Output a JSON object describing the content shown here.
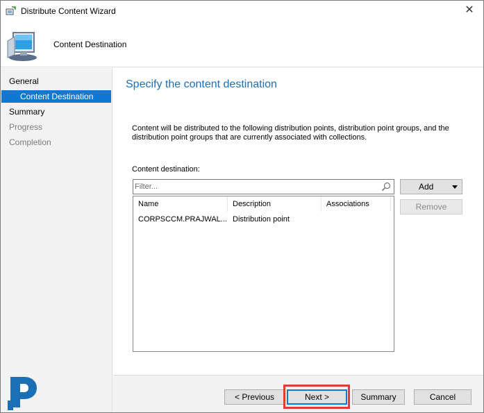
{
  "window": {
    "title": "Distribute Content Wizard",
    "close_glyph": "✕"
  },
  "header": {
    "title": "Content Destination",
    "icon": "computer-monitor-icon"
  },
  "nav": {
    "items": [
      {
        "label": "General",
        "state": "normal"
      },
      {
        "label": "Content Destination",
        "state": "selected"
      },
      {
        "label": "Summary",
        "state": "normal"
      },
      {
        "label": "Progress",
        "state": "disabled"
      },
      {
        "label": "Completion",
        "state": "disabled"
      }
    ]
  },
  "content": {
    "heading": "Specify the content destination",
    "description": "Content will be distributed to the following distribution points, distribution point groups, and the distribution point groups that are currently associated with collections.",
    "destination_label": "Content destination:",
    "filter_placeholder": "Filter...",
    "columns": [
      "Name",
      "Description",
      "Associations"
    ],
    "rows": [
      {
        "name": "CORPSCCM.PRAJWAL....",
        "description": "Distribution point",
        "associations": ""
      }
    ],
    "add_label": "Add",
    "remove_label": "Remove"
  },
  "footer": {
    "previous_label": "< Previous",
    "next_label": "Next >",
    "summary_label": "Summary",
    "cancel_label": "Cancel"
  },
  "colors": {
    "accent": "#0f78d5",
    "heading": "#1a6fb5",
    "highlight": "#e03c31"
  }
}
